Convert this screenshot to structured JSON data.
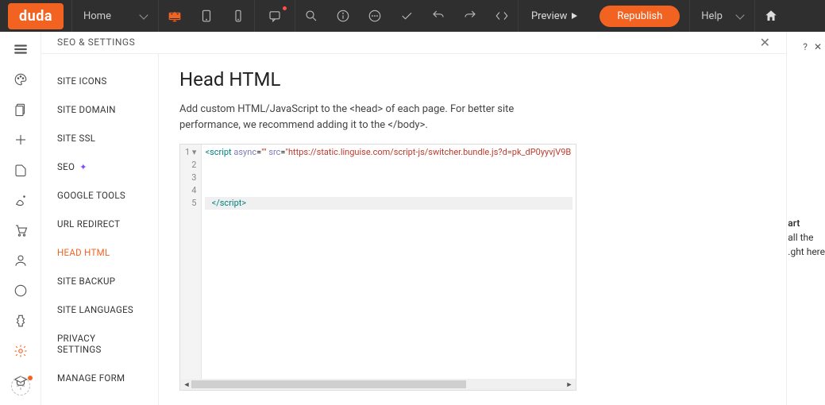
{
  "topbar": {
    "logo": "duda",
    "home_label": "Home",
    "preview_label": "Preview",
    "republish_label": "Republish",
    "help_label": "Help"
  },
  "panel": {
    "title": "SEO & SETTINGS"
  },
  "settings_nav": {
    "items": [
      {
        "label": "SITE ICONS",
        "active": false
      },
      {
        "label": "SITE DOMAIN",
        "active": false
      },
      {
        "label": "SITE SSL",
        "active": false
      },
      {
        "label": "SEO",
        "active": false,
        "sparkle": true
      },
      {
        "label": "GOOGLE TOOLS",
        "active": false
      },
      {
        "label": "URL REDIRECT",
        "active": false
      },
      {
        "label": "HEAD HTML",
        "active": true
      },
      {
        "label": "SITE BACKUP",
        "active": false
      },
      {
        "label": "SITE LANGUAGES",
        "active": false
      },
      {
        "label": "PRIVACY SETTINGS",
        "active": false
      },
      {
        "label": "MANAGE FORM",
        "active": false
      }
    ]
  },
  "editor": {
    "title": "Head HTML",
    "description": "Add custom HTML/JavaScript to the <head> of each page. For better site performance, we recommend adding it to the </body>.",
    "code_lines": [
      {
        "n": 1,
        "fold": true,
        "html": "<span class='tk-tag'>&lt;script</span> <span class='tk-attr'>async</span>=<span class='tk-str'>\"\"</span> <span class='tk-attr'>src</span>=<span class='tk-str'>\"https://static.linguise.com/script-js/switcher.bundle.js?d=pk_dP0yyvjV9B</span>"
      },
      {
        "n": 2,
        "html": ""
      },
      {
        "n": 3,
        "html": ""
      },
      {
        "n": 4,
        "html": ""
      },
      {
        "n": 5,
        "hl": true,
        "html": "&nbsp;&nbsp;&nbsp;<span class='tk-tag'>&lt;/script&gt;</span>"
      }
    ]
  },
  "right_sliver": {
    "line1": "art",
    "line2": "all the",
    "line3": "ght here."
  }
}
